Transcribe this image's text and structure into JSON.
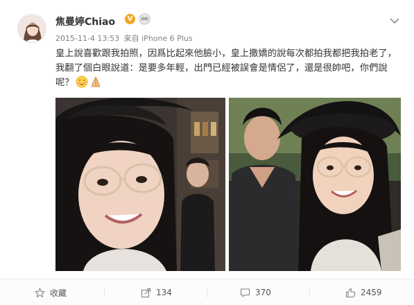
{
  "post": {
    "author": "焦曼婷Chiao",
    "verified_badge": "V",
    "timestamp": "2015-11-4 13:53",
    "source_prefix": "來自",
    "source_device": "iPhone 6 Plus",
    "text_lines": [
      "皇上說喜歡跟我拍照，因爲比起來他臉小，皇上撒嬌的說每次都拍我都把我拍老了，",
      "我翻了個白眼說道：是要多年輕，出門已經被誤會是情侶了，還是很帥吧，你們說",
      "呢？"
    ],
    "emoticons": [
      "blush-face-emoji",
      "pray-hands-emoji"
    ],
    "photos": [
      "photo-woman-glasses-hat",
      "photo-man-and-woman-selfie"
    ]
  },
  "actions": {
    "favorite_label": "收藏",
    "share_count": "134",
    "comment_count": "370",
    "like_count": "2459"
  },
  "icons": {
    "menu": "chevron-down-icon",
    "favorite": "star-icon",
    "share": "share-icon",
    "comment": "comment-icon",
    "like": "thumbs-up-icon",
    "member": "member-icon"
  },
  "colors": {
    "verified": "#f5a623",
    "meta_text": "#808080",
    "body_text": "#333333",
    "footer_bg": "#fcfcfc"
  }
}
